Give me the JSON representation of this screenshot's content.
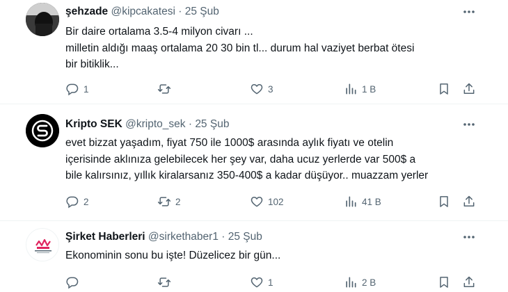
{
  "tweets": [
    {
      "name": "şehzade",
      "handle": "@kipcakatesi",
      "dot": "·",
      "date": "25 Şub",
      "lines": [
        "Bir daire ortalama 3.5-4 milyon civarı ...",
        "milletin aldığı maaş ortalama 20 30 bin tl... durum hal vaziyet berbat ötesi",
        "bir bitiklik..."
      ],
      "replies": "1",
      "retweets": "",
      "likes": "3",
      "views": "1 B"
    },
    {
      "name": "Kripto SEK",
      "handle": "@kripto_sek",
      "dot": "·",
      "date": "25 Şub",
      "lines": [
        "evet bizzat yaşadım, fiyat 750 ile 1000$ arasında aylık fiyatı ve otelin",
        "içerisinde aklınıza gelebilecek her şey var, daha ucuz yerlerde var 500$ a",
        "bile kalırsınız, yıllık kiralarsanız 350-400$ a kadar düşüyor.. muazzam yerler"
      ],
      "replies": "2",
      "retweets": "2",
      "likes": "102",
      "views": "41 B"
    },
    {
      "name": "Şirket Haberleri",
      "handle": "@sirkethaber1",
      "dot": "·",
      "date": "25 Şub",
      "lines": [
        "Ekonominin sonu bu işte! Düzelicez bir gün..."
      ],
      "replies": "",
      "retweets": "",
      "likes": "1",
      "views": "2 B"
    }
  ],
  "colors": {
    "text": "#0f1419",
    "muted": "#536471",
    "divider": "#eff3f4",
    "logo_red": "#e0245e"
  },
  "icons": [
    "reply-icon",
    "retweet-icon",
    "like-icon",
    "views-icon",
    "bookmark-icon",
    "share-icon",
    "more-icon"
  ]
}
